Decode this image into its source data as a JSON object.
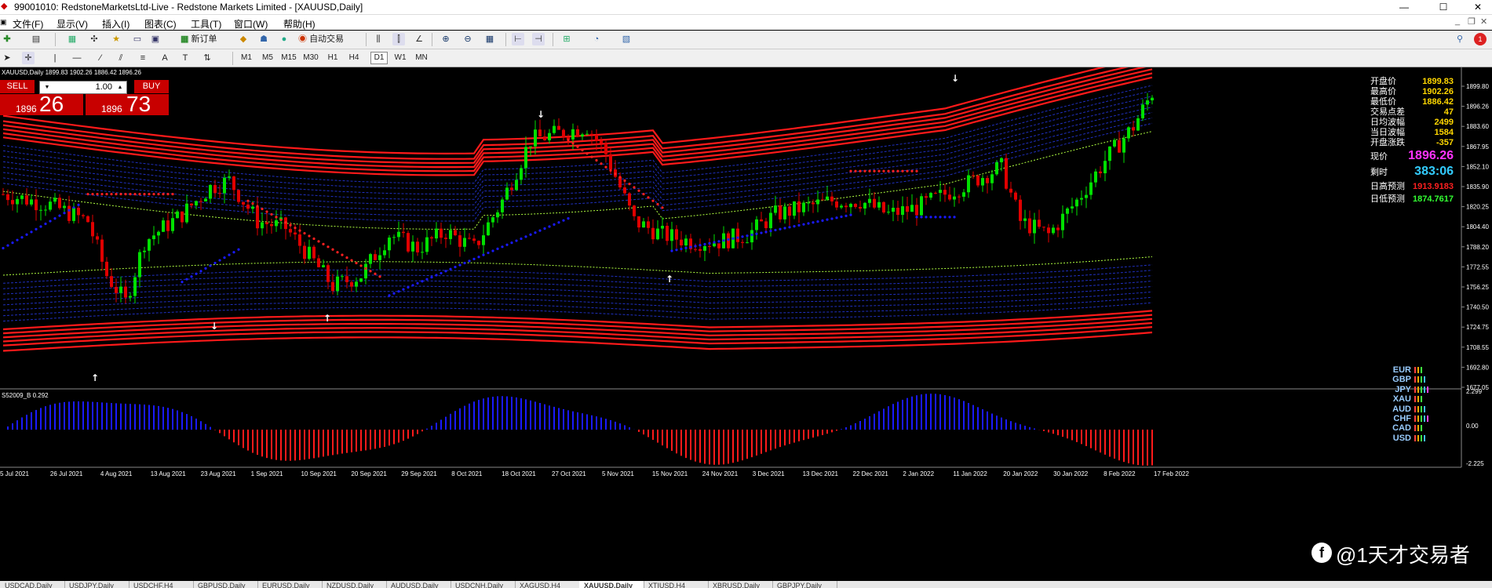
{
  "window": {
    "title": "99001010: RedstoneMarketsLtd-Live - Redstone Markets Limited - [XAUUSD,Daily]",
    "minimize": "—",
    "restore": "☐",
    "close": "✕"
  },
  "menu": {
    "items": [
      "文件(F)",
      "显示(V)",
      "插入(I)",
      "图表(C)",
      "工具(T)",
      "窗口(W)",
      "帮助(H)"
    ]
  },
  "toolbar": {
    "new_order": "新订单",
    "auto_trade": "自动交易",
    "timeframes": [
      "M1",
      "M5",
      "M15",
      "M30",
      "H1",
      "H4",
      "D1",
      "W1",
      "MN"
    ],
    "selected_timeframe": "D1",
    "notification_count": "1"
  },
  "chart": {
    "info_line": "XAUUSD,Daily  1899.83 1902.26 1886.42 1896.26",
    "sub_info": "S52009_B 0.292",
    "colors": {
      "bull": "#00e000",
      "bear": "#e00000",
      "band_red": "#ff1a1a",
      "band_blue": "#2030c0",
      "stop_blue": "#1a1aff",
      "stop_red": "#ff2020",
      "hist_blue": "#1a1aff",
      "hist_red": "#ff1a1a"
    }
  },
  "trade_panel": {
    "sell_label": "SELL",
    "buy_label": "BUY",
    "lot": "1.00",
    "bid_small": "1896",
    "bid_big": "26",
    "ask_small": "1896",
    "ask_big": "73"
  },
  "stats": [
    {
      "label": "开盘价",
      "value": "1899.83",
      "color": "#ffd700"
    },
    {
      "label": "最高价",
      "value": "1902.26",
      "color": "#ffd700"
    },
    {
      "label": "最低价",
      "value": "1886.42",
      "color": "#ffd700"
    },
    {
      "label": "交易点差",
      "value": "47",
      "color": "#ffd700"
    },
    {
      "label": "日均波幅",
      "value": "2499",
      "color": "#ffd700"
    },
    {
      "label": "当日波幅",
      "value": "1584",
      "color": "#ffd700"
    },
    {
      "label": "开盘涨跌",
      "value": "-357",
      "color": "#ffd700"
    }
  ],
  "stats2": [
    {
      "label": "现价",
      "value": "1896.26",
      "color": "#ff33ff"
    },
    {
      "label": "剩时",
      "value": "383:06",
      "color": "#33ccff"
    },
    {
      "label": "日高预测",
      "value": "1913.9183",
      "color": "#ff2020"
    },
    {
      "label": "日低预测",
      "value": "1874.7617",
      "color": "#33ff33"
    }
  ],
  "currencies": [
    "EUR",
    "GBP",
    "JPY",
    "XAU",
    "AUD",
    "CHF",
    "CAD",
    "USD"
  ],
  "price_axis": [
    "1899.80",
    "1896.26",
    "1883.60",
    "1867.95",
    "1852.10",
    "1835.90",
    "1820.25",
    "1804.40",
    "1788.20",
    "1772.55",
    "1756.25",
    "1740.50",
    "1724.75",
    "1708.55",
    "1692.80",
    "1677.05"
  ],
  "sub_axis": [
    "2.299",
    "0.00",
    "-2.225"
  ],
  "date_axis": [
    "5 Jul 2021",
    "26 Jul 2021",
    "4 Aug 2021",
    "13 Aug 2021",
    "23 Aug 2021",
    "1 Sep 2021",
    "10 Sep 2021",
    "20 Sep 2021",
    "29 Sep 2021",
    "8 Oct 2021",
    "18 Oct 2021",
    "27 Oct 2021",
    "5 Nov 2021",
    "15 Nov 2021",
    "24 Nov 2021",
    "3 Dec 2021",
    "13 Dec 2021",
    "22 Dec 2021",
    "2 Jan 2022",
    "11 Jan 2022",
    "20 Jan 2022",
    "30 Jan 2022",
    "8 Feb 2022",
    "17 Feb 2022"
  ],
  "tabs": [
    "USDCAD,Daily",
    "USDJPY,Daily",
    "USDCHF,H4",
    "GBPUSD,Daily",
    "EURUSD,Daily",
    "NZDUSD,Daily",
    "AUDUSD,Daily",
    "USDCNH,Daily",
    "XAGUSD,H4",
    "XAUUSD,Daily",
    "XTIUSD,H4",
    "XBRUSD,Daily",
    "GBPJPY,Daily"
  ],
  "active_tab": "XAUUSD,Daily",
  "watermark": "@1天才交易者"
}
